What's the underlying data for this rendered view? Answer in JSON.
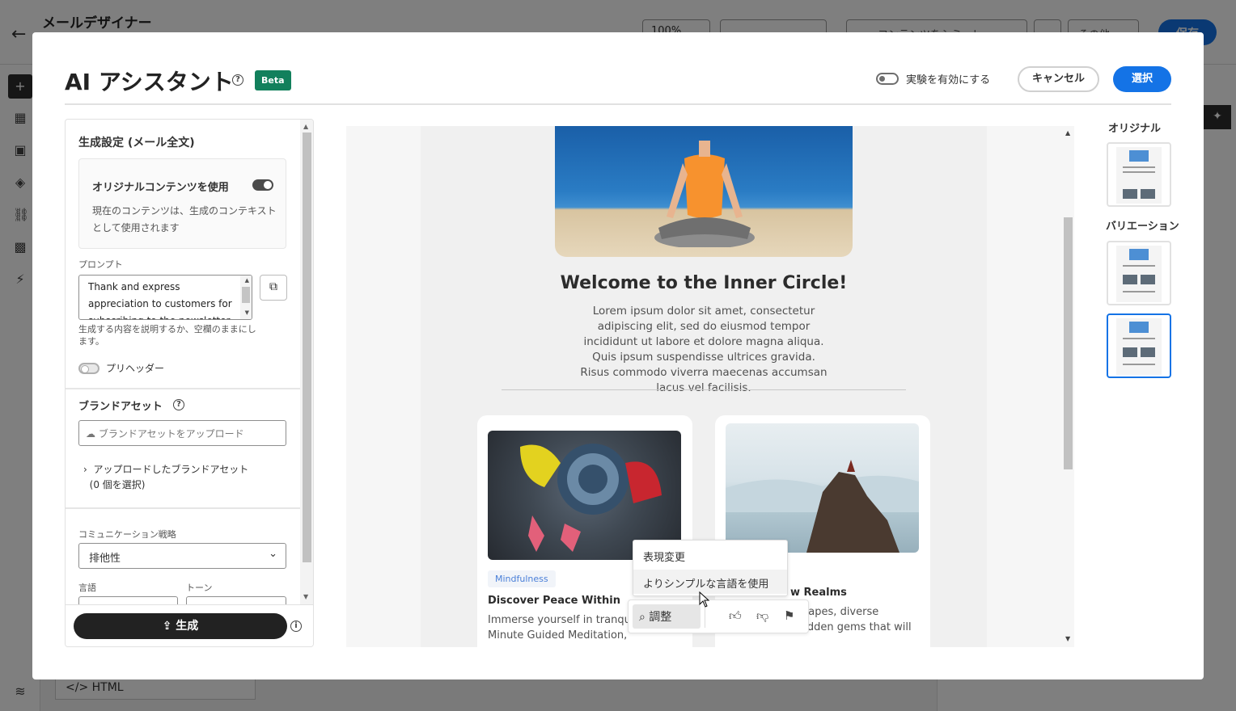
{
  "background": {
    "title": "メールデザイナー",
    "zoom": "100%",
    "content_button": "コンテンツをシミュレート",
    "more_label": "その他",
    "save_label": "保存",
    "html_row_label": "HTML"
  },
  "dialog": {
    "title": "AI アシスタント",
    "beta_badge": "Beta",
    "experiment_label": "実験を有効にする",
    "cancel_label": "キャンセル",
    "select_label": "選択"
  },
  "settings": {
    "heading": "生成設定 (メール全文)",
    "use_original_label": "オリジナルコンテンツを使用",
    "use_original_desc": "現在のコンテンツは、生成のコンテキストとして使用されます",
    "prompt_label": "プロンプト",
    "prompt_value": "Thank and express appreciation to customers for subscribing to the newsletter",
    "prompt_hint": "生成する内容を説明するか、空欄のままにします。",
    "preheader_label": "プリヘッダー",
    "brand_heading": "ブランドアセット",
    "upload_placeholder": "ブランドアセットをアップロード",
    "uploaded_label": "アップロードしたブランドアセット",
    "uploaded_count": "(0 個を選択)",
    "comm_label": "コミュニケーション戦略",
    "comm_value": "排他性",
    "lang_label": "言語",
    "tone_label": "トーン",
    "generate_label": "生成"
  },
  "preview": {
    "welcome": "Welcome to the Inner Circle!",
    "lorem": "Lorem ipsum dolor sit amet, consectetur adipiscing elit, sed do eiusmod tempor incididunt ut labore et dolore magna aliqua. Quis ipsum suspendisse ultrices gravida. Risus commodo viverra maecenas accumsan lacus vel facilisis.",
    "card1": {
      "tag": "Mindfulness",
      "title": "Discover Peace Within",
      "text": "Immerse yourself in tranqui our 15 Minute Guided Meditation,"
    },
    "card2": {
      "title": "w Realms",
      "text": "rney through scapes, diverse cultures, and hidden gems that will"
    }
  },
  "popup": {
    "item1": "表現変更",
    "item2": "よりシンプルな言語を使用",
    "adjust_label": "調整"
  },
  "thumbnails": {
    "original_label": "オリジナル",
    "variation_label": "バリエーション"
  },
  "colors": {
    "accent": "#1473e6",
    "beta": "#12805c",
    "generate": "#222222"
  }
}
